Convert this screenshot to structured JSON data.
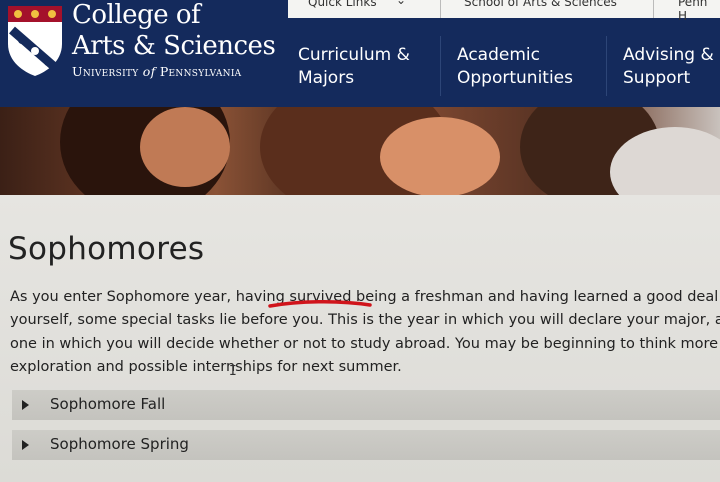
{
  "header": {
    "college_title_line1": "College of",
    "college_title_line2": "Arts & Sciences",
    "university_part1": "University",
    "university_of": "of",
    "university_part2": "Pennsylvania",
    "colors": {
      "navy": "#142a5c",
      "white": "#ffffff"
    }
  },
  "topbar": {
    "quick_links": "Quick Links",
    "school": "School of Arts & Sciences",
    "penn": "Penn H"
  },
  "nav": {
    "items": [
      {
        "line1": "Curriculum &",
        "line2": "Majors"
      },
      {
        "line1": "Academic",
        "line2": "Opportunities"
      },
      {
        "line1": "Advising &",
        "line2": "Support"
      }
    ]
  },
  "page": {
    "title": "Sophomores",
    "paragraph_lines": [
      "As you enter Sophomore year, having survived being a freshman and having learned a good deal ab",
      "yourself, some special tasks lie before you. This is the year in which you will declare your major, and",
      "one in which you will decide whether or not to study abroad. You may be beginning to think more a",
      "exploration and possible internships for next summer."
    ],
    "annotation_color": "#d0141b"
  },
  "accordion": [
    {
      "label": "Sophomore Fall"
    },
    {
      "label": "Sophomore Spring"
    }
  ]
}
